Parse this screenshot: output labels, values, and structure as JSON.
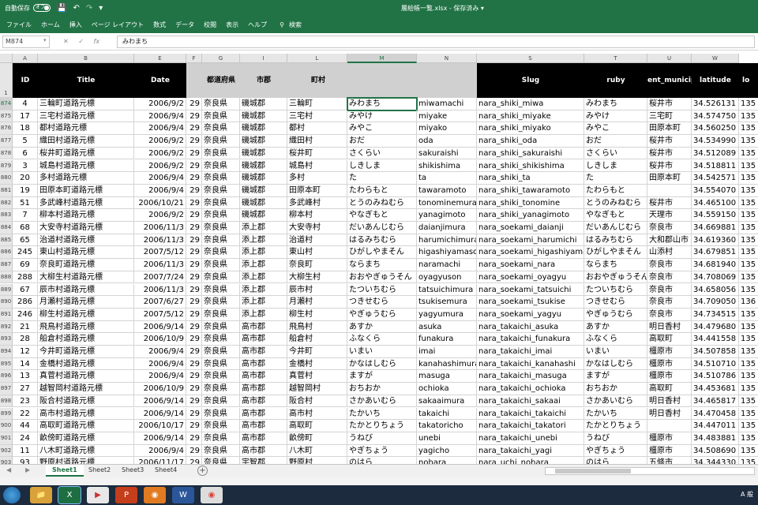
{
  "titlebar": {
    "autosave_label": "自動保存",
    "autosave_state": "オフ",
    "filename": "層絵帳一覧.xlsx - 保存済み ▾"
  },
  "ribbon": {
    "tabs": [
      "ファイル",
      "ホーム",
      "挿入",
      "ページ レイアウト",
      "数式",
      "データ",
      "校閲",
      "表示",
      "ヘルプ"
    ],
    "search_label": "検索"
  },
  "formula_bar": {
    "name_box": "M874",
    "formula": "みわまち"
  },
  "columns": [
    "A",
    "B",
    "E",
    "F",
    "G",
    "I",
    "L",
    "M",
    "N",
    "S",
    "T",
    "U",
    "W"
  ],
  "header_row": {
    "row_number": "1",
    "cells": [
      "ID",
      "Title",
      "Date",
      "",
      "都道府県",
      "市郡",
      "町村",
      "",
      "",
      "Slug",
      "ruby",
      "ent_municip",
      "latitude",
      "lo"
    ]
  },
  "rows": [
    {
      "n": "874",
      "c": [
        "4",
        "三輪町道路元標",
        "2006/9/2",
        "29",
        "奈良県",
        "磯城郡",
        "三輪町",
        "みわまち",
        "miwamachi",
        "nara_shiki_miwa",
        "みわまち",
        "桜井市",
        "34.526131",
        "135"
      ]
    },
    {
      "n": "875",
      "c": [
        "17",
        "三宅村道路元標",
        "2006/9/4",
        "29",
        "奈良県",
        "磯城郡",
        "三宅村",
        "みやけ",
        "miyake",
        "nara_shiki_miyake",
        "みやけ",
        "三宅町",
        "34.574750",
        "135"
      ]
    },
    {
      "n": "876",
      "c": [
        "18",
        "都村道路元標",
        "2006/9/4",
        "29",
        "奈良県",
        "磯城郡",
        "都村",
        "みやこ",
        "miyako",
        "nara_shiki_miyako",
        "みやこ",
        "田原本町",
        "34.560250",
        "135"
      ]
    },
    {
      "n": "877",
      "c": [
        "5",
        "織田村道路元標",
        "2006/9/2",
        "29",
        "奈良県",
        "磯城郡",
        "織田村",
        "おだ",
        "oda",
        "nara_shiki_oda",
        "おだ",
        "桜井市",
        "34.534990",
        "135"
      ]
    },
    {
      "n": "878",
      "c": [
        "6",
        "桜井町道路元標",
        "2006/9/2",
        "29",
        "奈良県",
        "磯城郡",
        "桜井町",
        "さくらい",
        "sakuraishi",
        "nara_shiki_sakuraishi",
        "さくらい",
        "桜井市",
        "34.512089",
        "135"
      ]
    },
    {
      "n": "879",
      "c": [
        "3",
        "城島村道路元標",
        "2006/9/2",
        "29",
        "奈良県",
        "磯城郡",
        "城島村",
        "しきしま",
        "shikishima",
        "nara_shiki_shikishima",
        "しきしま",
        "桜井市",
        "34.518811",
        "135"
      ]
    },
    {
      "n": "880",
      "c": [
        "20",
        "多村道路元標",
        "2006/9/4",
        "29",
        "奈良県",
        "磯城郡",
        "多村",
        "た",
        "ta",
        "nara_shiki_ta",
        "た",
        "田原本町",
        "34.542571",
        "135"
      ]
    },
    {
      "n": "881",
      "c": [
        "19",
        "田原本町道路元標",
        "2006/9/4",
        "29",
        "奈良県",
        "磯城郡",
        "田原本町",
        "たわらもと",
        "tawaramoto",
        "nara_shiki_tawaramoto",
        "たわらもと",
        "",
        "34.554070",
        "135"
      ]
    },
    {
      "n": "882",
      "c": [
        "51",
        "多武峰村道路元標",
        "2006/10/21",
        "29",
        "奈良県",
        "磯城郡",
        "多武峰村",
        "とうのみねむら",
        "tonominemura",
        "nara_shiki_tonomine",
        "とうのみねむら",
        "桜井市",
        "34.465100",
        "135"
      ]
    },
    {
      "n": "883",
      "c": [
        "7",
        "柳本村道路元標",
        "2006/9/2",
        "29",
        "奈良県",
        "磯城郡",
        "柳本村",
        "やなぎもと",
        "yanagimoto",
        "nara_shiki_yanagimoto",
        "やなぎもと",
        "天理市",
        "34.559150",
        "135"
      ]
    },
    {
      "n": "884",
      "c": [
        "68",
        "大安寺村道路元標",
        "2006/11/3",
        "29",
        "奈良県",
        "添上郡",
        "大安寺村",
        "だいあんじむら",
        "daianjimura",
        "nara_soekami_daianji",
        "だいあんじむら",
        "奈良市",
        "34.669881",
        "135"
      ]
    },
    {
      "n": "885",
      "c": [
        "65",
        "治道村道路元標",
        "2006/11/3",
        "29",
        "奈良県",
        "添上郡",
        "治道村",
        "はるみちむら",
        "harumichimura",
        "nara_soekami_harumichi",
        "はるみちむら",
        "大和郡山市",
        "34.619360",
        "135"
      ]
    },
    {
      "n": "886",
      "c": [
        "245",
        "東山村道路元標",
        "2007/5/12",
        "29",
        "奈良県",
        "添上郡",
        "東山村",
        "ひがしやまそん",
        "higashiyamason",
        "nara_soekami_higashiyama",
        "ひがしやまそん",
        "山添村",
        "34.679851",
        "135"
      ]
    },
    {
      "n": "887",
      "c": [
        "69",
        "奈良町道路元標",
        "2006/11/3",
        "29",
        "奈良県",
        "添上郡",
        "奈良町",
        "ならまち",
        "naramachi",
        "nara_soekami_nara",
        "ならまち",
        "奈良市",
        "34.681940",
        "135"
      ]
    },
    {
      "n": "888",
      "c": [
        "288",
        "大柳生村道路元標",
        "2007/7/24",
        "29",
        "奈良県",
        "添上郡",
        "大柳生村",
        "おおやぎゅうそん",
        "oyagyuson",
        "nara_soekami_oyagyu",
        "おおやぎゅうそん",
        "奈良市",
        "34.708069",
        "135"
      ]
    },
    {
      "n": "889",
      "c": [
        "67",
        "辰市村道路元標",
        "2006/11/3",
        "29",
        "奈良県",
        "添上郡",
        "辰市村",
        "たついちむら",
        "tatsuichimura",
        "nara_soekami_tatsuichi",
        "たついちむら",
        "奈良市",
        "34.658056",
        "135"
      ]
    },
    {
      "n": "890",
      "c": [
        "286",
        "月瀬村道路元標",
        "2007/6/27",
        "29",
        "奈良県",
        "添上郡",
        "月瀬村",
        "つきせむら",
        "tsukisemura",
        "nara_soekami_tsukise",
        "つきせむら",
        "奈良市",
        "34.709050",
        "136"
      ]
    },
    {
      "n": "891",
      "c": [
        "246",
        "柳生村道路元標",
        "2007/5/12",
        "29",
        "奈良県",
        "添上郡",
        "柳生村",
        "やぎゅうむら",
        "yagyumura",
        "nara_soekami_yagyu",
        "やぎゅうむら",
        "奈良市",
        "34.734515",
        "135"
      ]
    },
    {
      "n": "892",
      "c": [
        "21",
        "飛鳥村道路元標",
        "2006/9/14",
        "29",
        "奈良県",
        "高市郡",
        "飛鳥村",
        "あすか",
        "asuka",
        "nara_takaichi_asuka",
        "あすか",
        "明日香村",
        "34.479680",
        "135"
      ]
    },
    {
      "n": "893",
      "c": [
        "28",
        "船倉村道路元標",
        "2006/10/9",
        "29",
        "奈良県",
        "高市郡",
        "船倉村",
        "ふなくら",
        "funakura",
        "nara_takaichi_funakura",
        "ふなくら",
        "高取町",
        "34.441558",
        "135"
      ]
    },
    {
      "n": "894",
      "c": [
        "12",
        "今井町道路元標",
        "2006/9/4",
        "29",
        "奈良県",
        "高市郡",
        "今井町",
        "いまい",
        "imai",
        "nara_takaichi_imai",
        "いまい",
        "橿原市",
        "34.507858",
        "135"
      ]
    },
    {
      "n": "895",
      "c": [
        "14",
        "金橋村道路元標",
        "2006/9/4",
        "29",
        "奈良県",
        "高市郡",
        "金橋村",
        "かなはしむら",
        "kanahashimura",
        "nara_takaichi_kanahashi",
        "かなはしむら",
        "橿原市",
        "34.510710",
        "135"
      ]
    },
    {
      "n": "896",
      "c": [
        "13",
        "真菅村道路元標",
        "2006/9/4",
        "29",
        "奈良県",
        "高市郡",
        "真菅村",
        "ますが",
        "masuga",
        "nara_takaichi_masuga",
        "ますが",
        "橿原市",
        "34.510786",
        "135"
      ]
    },
    {
      "n": "897",
      "c": [
        "27",
        "越智岡村道路元標",
        "2006/10/9",
        "29",
        "奈良県",
        "高市郡",
        "越智岡村",
        "おちおか",
        "ochioka",
        "nara_takaichi_ochioka",
        "おちおか",
        "高取町",
        "34.453681",
        "135"
      ]
    },
    {
      "n": "898",
      "c": [
        "23",
        "阪合村道路元標",
        "2006/9/14",
        "29",
        "奈良県",
        "高市郡",
        "阪合村",
        "さかあいむら",
        "sakaaimura",
        "nara_takaichi_sakaai",
        "さかあいむら",
        "明日香村",
        "34.465817",
        "135"
      ]
    },
    {
      "n": "899",
      "c": [
        "22",
        "高市村道路元標",
        "2006/9/14",
        "29",
        "奈良県",
        "高市郡",
        "高市村",
        "たかいち",
        "takaichi",
        "nara_takaichi_takaichi",
        "たかいち",
        "明日香村",
        "34.470458",
        "135"
      ]
    },
    {
      "n": "900",
      "c": [
        "44",
        "高取町道路元標",
        "2006/10/17",
        "29",
        "奈良県",
        "高市郡",
        "高取町",
        "たかとりちょう",
        "takatoricho",
        "nara_takaichi_takatori",
        "たかとりちょう",
        "",
        "34.447011",
        "135"
      ]
    },
    {
      "n": "901",
      "c": [
        "24",
        "畝傍町道路元標",
        "2006/9/14",
        "29",
        "奈良県",
        "高市郡",
        "畝傍町",
        "うねび",
        "unebi",
        "nara_takaichi_unebi",
        "うねび",
        "橿原市",
        "34.483881",
        "135"
      ]
    },
    {
      "n": "902",
      "c": [
        "11",
        "八木町道路元標",
        "2006/9/4",
        "29",
        "奈良県",
        "高市郡",
        "八木町",
        "やぎちょう",
        "yagicho",
        "nara_takaichi_yagi",
        "やぎちょう",
        "橿原市",
        "34.508690",
        "135"
      ]
    },
    {
      "n": "903",
      "c": [
        "93",
        "野原村道路元標",
        "2006/11/17",
        "29",
        "奈良県",
        "宇智郡",
        "野原村",
        "のはら",
        "nohara",
        "nara_uchi_nohara",
        "のはら",
        "五條市",
        "34.344330",
        "135"
      ]
    }
  ],
  "sheet_tabs": [
    "Sheet1",
    "Sheet2",
    "Sheet3",
    "Sheet4"
  ],
  "active_sheet": "Sheet1"
}
